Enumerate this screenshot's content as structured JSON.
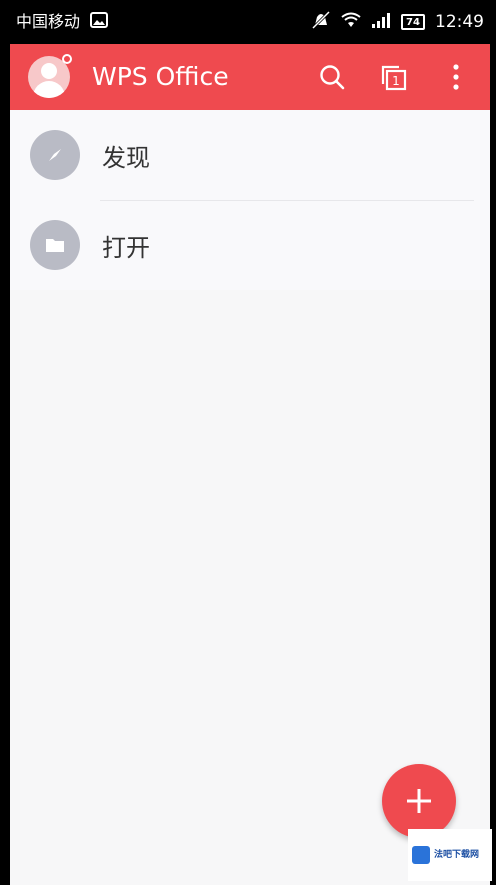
{
  "status_bar": {
    "carrier": "中国移动",
    "battery": "74",
    "time": "12:49"
  },
  "app_bar": {
    "title": "WPS Office",
    "tab_count": "1"
  },
  "list": {
    "items": [
      {
        "label": "发现",
        "icon": "compass-icon"
      },
      {
        "label": "打开",
        "icon": "folder-icon"
      }
    ]
  },
  "watermark": {
    "text": "法吧下载网"
  },
  "colors": {
    "accent": "#ef4a4f",
    "icon_circle": "#b9bbc5"
  }
}
